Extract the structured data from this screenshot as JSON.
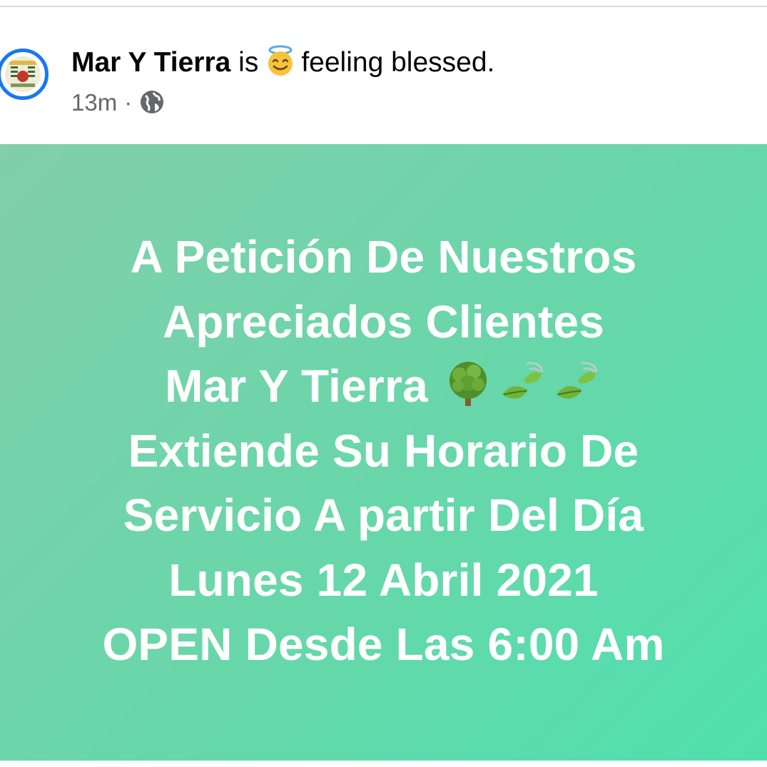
{
  "post": {
    "author": "Mar Y Tierra",
    "activity_prefix": "is",
    "activity_emoji": "smiling-face-with-halo-icon",
    "activity_text": "feeling blessed.",
    "timestamp": "13m",
    "separator": "·",
    "privacy_icon": "globe-icon"
  },
  "banner": {
    "background_start": "#82cfa9",
    "background_end": "#50e0ad",
    "text_color": "#ffffff",
    "lines": [
      "A Petición De Nuestros",
      "Apreciados Clientes",
      "Mar Y Tierra",
      "Extiende Su Horario De",
      "Servicio A partir Del Día",
      "Lunes 12 Abril 2021",
      "OPEN Desde Las 6:00 Am"
    ],
    "line3_emojis": [
      "deciduous-tree-icon",
      "leaf-fluttering-in-wind-icon",
      "leaf-fluttering-in-wind-icon"
    ]
  },
  "colors": {
    "avatar_ring": "#1877f2",
    "meta_text": "#65676b",
    "author_text": "#050505"
  }
}
